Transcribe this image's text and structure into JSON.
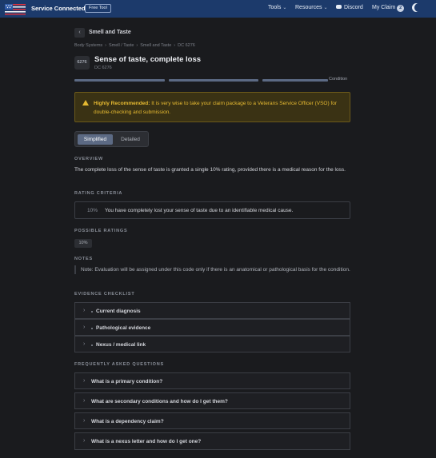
{
  "header": {
    "brand": "Service Connected",
    "badge": "Free Tool",
    "nav": [
      {
        "label": "Tools",
        "chevron": "⌄"
      },
      {
        "label": "Resources",
        "chevron": "⌄"
      },
      {
        "label": "Discord"
      },
      {
        "label": "My Claim",
        "count": "2"
      }
    ]
  },
  "page": {
    "back_title": "Smell and Taste",
    "breadcrumb": [
      "Body Systems",
      "Smell / Taste",
      "Smell and Taste",
      "DC 6276"
    ],
    "code": "6276",
    "title": "Sense of taste, complete loss",
    "dc": "DC 6276",
    "progress_label": "Condition"
  },
  "alert": {
    "strong": "Highly Recommended:",
    "text": " It is very wise to take your claim package to a Veterans Service Officer (VSO) for double-checking and submission."
  },
  "view_toggle": {
    "simplified": "Simplified",
    "detailed": "Detailed"
  },
  "overview": {
    "label": "OVERVIEW",
    "text": "The complete loss of the sense of taste is granted a single 10% rating, provided there is a medical reason for the loss."
  },
  "rating_criteria": {
    "label": "RATING CRITERIA",
    "percent": "10%",
    "text": "You have completely lost your sense of taste due to an identifiable medical cause."
  },
  "possible_ratings": {
    "label": "POSSIBLE RATINGS",
    "values": [
      "10%"
    ]
  },
  "notes": {
    "label": "NOTES",
    "text": "Note: Evaluation will be assigned under this code only if there is an anatomical or pathological basis for the condition."
  },
  "evidence": {
    "label": "EVIDENCE CHECKLIST",
    "items": [
      "Current diagnosis",
      "Pathological evidence",
      "Nexus / medical link"
    ]
  },
  "faq": {
    "label": "FREQUENTLY ASKED QUESTIONS",
    "items": [
      "What is a primary condition?",
      "What are secondary conditions and how do I get them?",
      "What is a dependency claim?",
      "What is a nexus letter and how do I get one?"
    ]
  },
  "colors": {
    "header_bg": "#1c3a6b",
    "page_bg": "#1a1b1e",
    "alert_text": "#e5b931",
    "accent": "#5c6a84"
  }
}
